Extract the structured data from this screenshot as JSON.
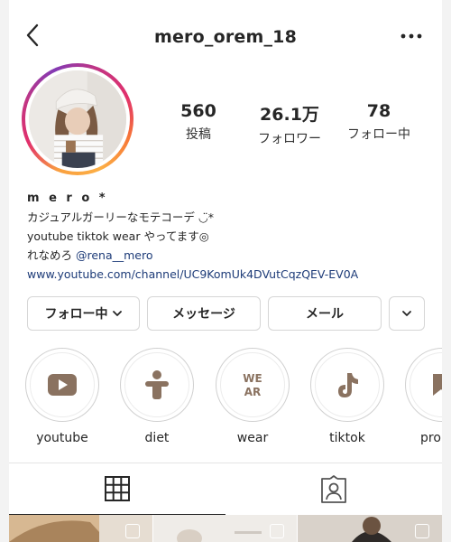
{
  "header": {
    "username": "mero_orem_18",
    "back_icon": "chevron-left-icon",
    "more_icon": "ellipsis-icon"
  },
  "profile": {
    "stats": [
      {
        "value": "560",
        "label": "投稿"
      },
      {
        "value": "26.1万",
        "label": "フォロワー"
      },
      {
        "value": "78",
        "label": "フォロー中"
      }
    ],
    "bio": {
      "name": "m e r o *",
      "line1": "カジュアルガーリーなモテコーデ ◡̈*",
      "line2": "youtube tiktok wear やってます◎",
      "line3_prefix": "れなめろ ",
      "line3_mention": "@rena__mero",
      "link": "www.youtube.com/channel/UC9KomUk4DVutCqzQEV-EV0A"
    }
  },
  "actions": {
    "following": "フォロー中",
    "message": "メッセージ",
    "email": "メール"
  },
  "highlights": [
    {
      "label": "youtube",
      "icon": "youtube-icon"
    },
    {
      "label": "diet",
      "icon": "person-icon"
    },
    {
      "label": "wear",
      "icon": "wear-logo-icon",
      "icon_text": "WE\nAR"
    },
    {
      "label": "tiktok",
      "icon": "tiktok-icon"
    },
    {
      "label": "pro",
      "icon": "bookmark-icon"
    }
  ],
  "tabs": [
    {
      "name": "posts-grid",
      "icon": "grid-icon",
      "active": true
    },
    {
      "name": "tagged",
      "icon": "tagged-person-icon",
      "active": false
    }
  ],
  "colors": {
    "accent_link": "#1d3b78",
    "highlight_icon": "#8a7260",
    "ring_gradient": [
      "#f9a03f",
      "#e1306c",
      "#833ab4"
    ]
  }
}
